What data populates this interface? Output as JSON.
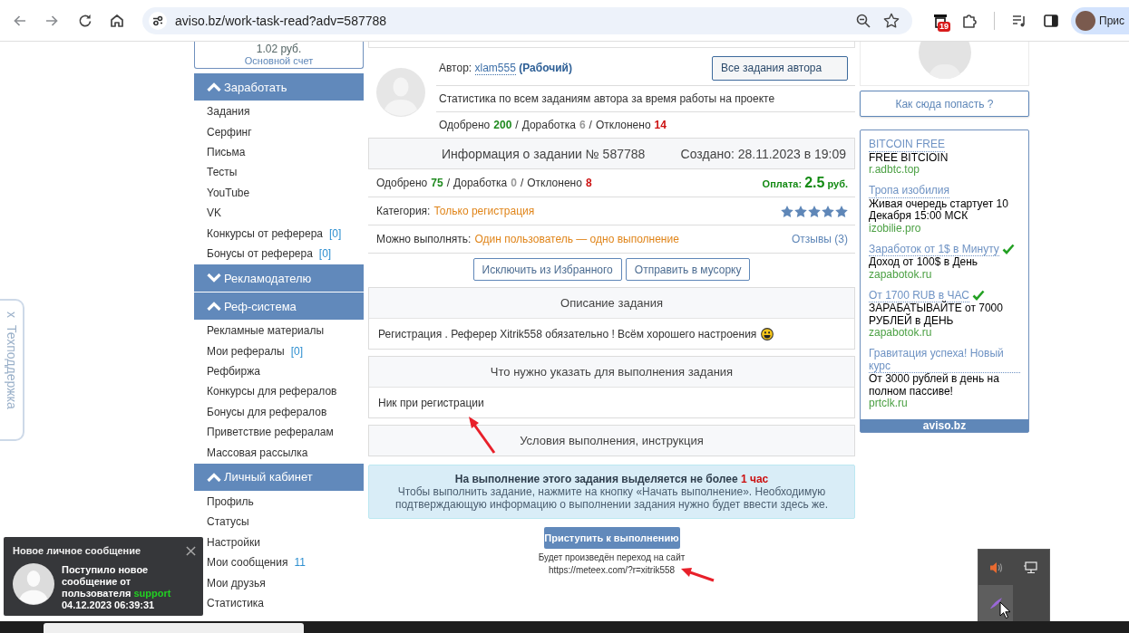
{
  "browser": {
    "url": "aviso.bz/work-task-read?adv=587788",
    "extension_badge": "19",
    "profile_name": "Прис"
  },
  "support_tab": {
    "close": "x",
    "label": "Техподдержка"
  },
  "account": {
    "balance": "1.02 руб.",
    "label": "Основной счет"
  },
  "sidebar": [
    {
      "title": "Заработать",
      "expanded": true,
      "items": [
        {
          "label": "Задания"
        },
        {
          "label": "Серфинг"
        },
        {
          "label": "Письма"
        },
        {
          "label": "Тесты"
        },
        {
          "label": "YouTube"
        },
        {
          "label": "VK"
        },
        {
          "label": "Конкурсы от реферера",
          "count": "[0]"
        },
        {
          "label": "Бонусы от реферера",
          "count": "[0]"
        }
      ]
    },
    {
      "title": "Рекламодателю",
      "expanded": false
    },
    {
      "title": "Реф-система",
      "expanded": true,
      "items": [
        {
          "label": "Рекламные материалы"
        },
        {
          "label": "Мои рефералы",
          "count": "[0]"
        },
        {
          "label": "Рефбиржа"
        },
        {
          "label": "Конкурсы для рефералов"
        },
        {
          "label": "Бонусы для рефералов"
        },
        {
          "label": "Приветствие рефералам"
        },
        {
          "label": "Массовая рассылка"
        }
      ]
    },
    {
      "title": "Личный кабинет",
      "expanded": true,
      "items": [
        {
          "label": "Профиль"
        },
        {
          "label": "Статусы"
        },
        {
          "label": "Настройки"
        },
        {
          "label": "Мои сообщения",
          "count": "11"
        },
        {
          "label": "Мои друзья"
        },
        {
          "label": "Статистика"
        }
      ]
    }
  ],
  "author": {
    "label": "Автор:",
    "name": "xlam555",
    "status": "(Рабочий)",
    "button": "Все задания автора",
    "stats_title": "Статистика по всем заданиям автора за время работы на проекте",
    "stats": [
      {
        "label": "Одобрено",
        "value": "200",
        "color": "#1f8a1f"
      },
      {
        "label": "Доработка",
        "value": "6",
        "color": "#999999"
      },
      {
        "label": "Отклонено",
        "value": "14",
        "color": "#cc1111"
      }
    ],
    "separator": "/"
  },
  "task": {
    "title": "Информация о задании № 587788",
    "created": "Создано: 28.11.2023 в 19:09",
    "stats": [
      {
        "label": "Одобрено",
        "value": "75",
        "color": "#1f8a1f"
      },
      {
        "label": "Доработка",
        "value": "0",
        "color": "#999999"
      },
      {
        "label": "Отклонено",
        "value": "8",
        "color": "#cc1111"
      }
    ],
    "separator": "/",
    "payment": {
      "label": "Оплата:",
      "amount": "2.5",
      "currency": "руб."
    },
    "category": {
      "label": "Категория:",
      "value": "Только регистрация"
    },
    "rating": {
      "stars": 5
    },
    "limit": {
      "label": "Можно выполнять:",
      "value": "Один пользователь — одно выполнение"
    },
    "reviews": "Отзывы (3)",
    "actions": [
      "Исключить из Избранного",
      "Отправить в мусорку"
    ]
  },
  "panels": [
    {
      "title": "Описание задания",
      "body": "Регистрация . Реферер Xitrik558 обязательно ! Всём хорошего настроения",
      "smiley": true
    },
    {
      "title": "Что нужно указать для выполнения задания",
      "body": "Ник при регистрации",
      "smiley": false
    },
    {
      "title": "Условия выполнения, инструкция",
      "smiley": false
    }
  ],
  "notice": {
    "title": "На выполнение этого задания выделяется не более",
    "limit": "1 час",
    "text": "Чтобы выполнить задание, нажмите на кнопку «Начать выполнение». Необходимую подтверждающую информацию о выполнении задания нужно будет ввести здесь же."
  },
  "start": {
    "button": "Приступить к выполнению",
    "note": "Будет произведён переход на сайт",
    "url": "https://meteex.com/?r=xitrik558"
  },
  "right": {
    "how_button": "Как сюда попасть ?",
    "ads": [
      {
        "title": "BITCOIN FREE",
        "verified": false,
        "text": "FREE BITCIOIN",
        "domain": "r.adbtc.top"
      },
      {
        "title": "Тропа изобилия",
        "verified": false,
        "text": "Живая очередь стартует 10 Декабря 15:00 МСК",
        "domain": "izobilie.pro"
      },
      {
        "title": "Заработок от 1$ в Минуту",
        "verified": true,
        "text": "Доход от 100$ в День",
        "domain": "zapabotok.ru"
      },
      {
        "title": "От 1700 RUB в ЧАС",
        "verified": true,
        "text": "ЗАРАБАТЫВАЙТЕ от 7000 РУБЛЕЙ в ДЕНЬ",
        "domain": "zapabotok.ru"
      },
      {
        "title": "Гравитация успеха! Новый курс",
        "verified": false,
        "text": "От 3000 рублей в день на полном пассиве!",
        "domain": "prtclk.ru"
      }
    ],
    "footer": "aviso.bz"
  },
  "notification": {
    "title": "Новое личное сообщение",
    "text": "Поступило новое сообщение от пользователя",
    "sender": "support",
    "time": "04.12.2023 06:39:31"
  }
}
